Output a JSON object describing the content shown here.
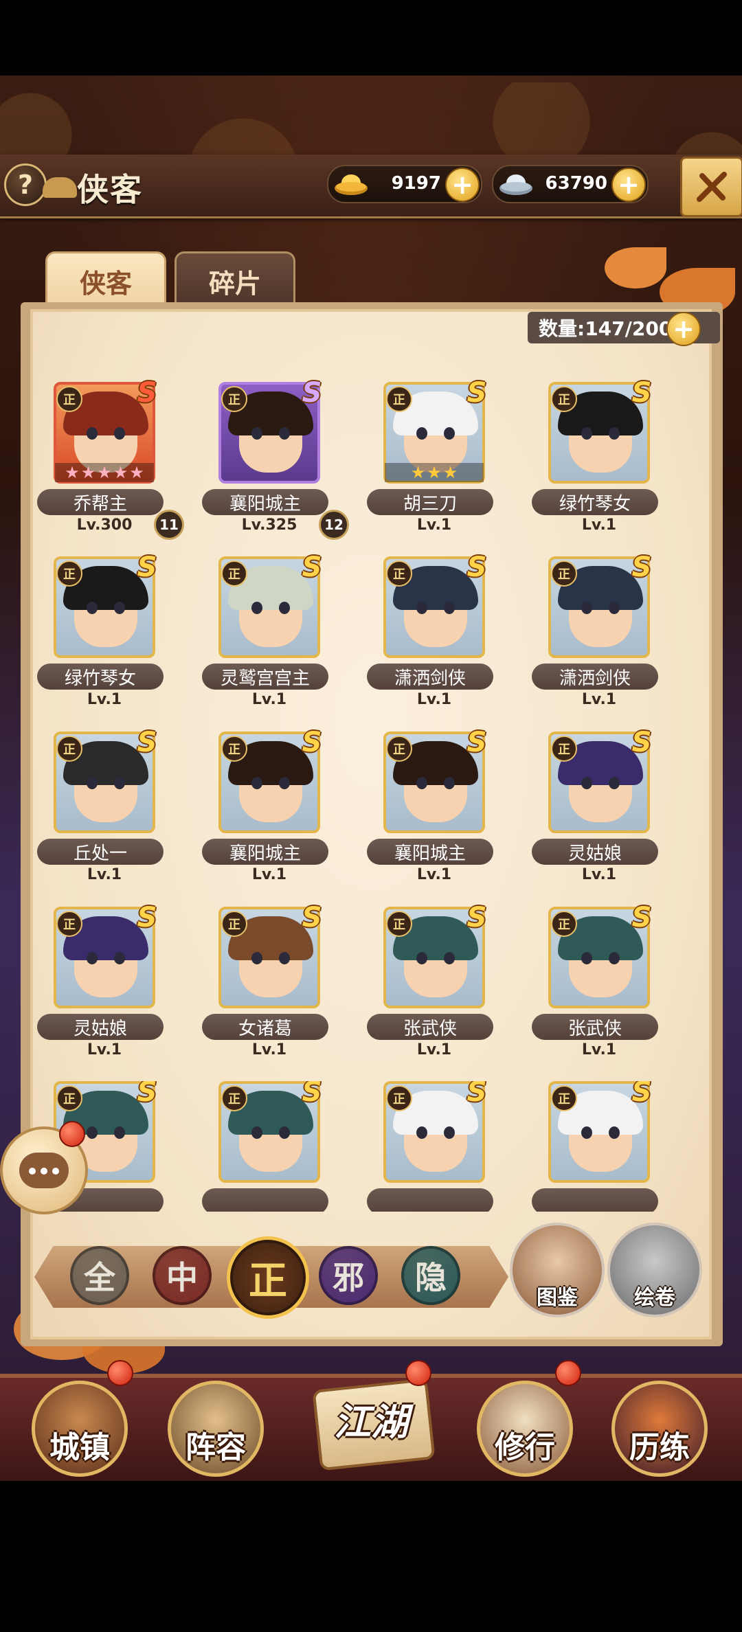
{
  "header": {
    "help_label": "?",
    "title": "侠客",
    "gold": "9197",
    "silver": "63790",
    "plus": "+"
  },
  "tabs": [
    {
      "label": "侠客",
      "active": true
    },
    {
      "label": "碎片",
      "active": false
    }
  ],
  "count_label": "数量:147/200",
  "heroes": [
    {
      "name": "乔帮主",
      "level": "Lv.300",
      "badge": "11",
      "grade": "S",
      "frame": "red",
      "stars": 5,
      "star_color": "pink",
      "hair": "#8a2a1a"
    },
    {
      "name": "襄阳城主",
      "level": "Lv.325",
      "badge": "12",
      "grade": "S",
      "frame": "purple",
      "stars": 0,
      "hair": "#2a1a12"
    },
    {
      "name": "胡三刀",
      "level": "Lv.1",
      "badge": "",
      "grade": "S",
      "frame": "gold",
      "stars": 3,
      "star_color": "gold",
      "hair": "#f2f2f2"
    },
    {
      "name": "绿竹琴女",
      "level": "Lv.1",
      "badge": "",
      "grade": "S",
      "frame": "gold",
      "stars": 0,
      "hair": "#1a1a1a"
    },
    {
      "name": "绿竹琴女",
      "level": "Lv.1",
      "badge": "",
      "grade": "S",
      "frame": "gold",
      "stars": 0,
      "hair": "#1a1a1a"
    },
    {
      "name": "灵鹫宫宫主",
      "level": "Lv.1",
      "badge": "",
      "grade": "S",
      "frame": "gold",
      "stars": 0,
      "hair": "#cfd6c6"
    },
    {
      "name": "潇洒剑侠",
      "level": "Lv.1",
      "badge": "",
      "grade": "S",
      "frame": "gold",
      "stars": 0,
      "hair": "#2a3448"
    },
    {
      "name": "潇洒剑侠",
      "level": "Lv.1",
      "badge": "",
      "grade": "S",
      "frame": "gold",
      "stars": 0,
      "hair": "#2a3448"
    },
    {
      "name": "丘处一",
      "level": "Lv.1",
      "badge": "",
      "grade": "S",
      "frame": "gold",
      "stars": 0,
      "hair": "#2a2a2a"
    },
    {
      "name": "襄阳城主",
      "level": "Lv.1",
      "badge": "",
      "grade": "S",
      "frame": "gold",
      "stars": 0,
      "hair": "#2a1a12"
    },
    {
      "name": "襄阳城主",
      "level": "Lv.1",
      "badge": "",
      "grade": "S",
      "frame": "gold",
      "stars": 0,
      "hair": "#2a1a12"
    },
    {
      "name": "灵姑娘",
      "level": "Lv.1",
      "badge": "",
      "grade": "S",
      "frame": "gold",
      "stars": 0,
      "hair": "#3a2c6a"
    },
    {
      "name": "灵姑娘",
      "level": "Lv.1",
      "badge": "",
      "grade": "S",
      "frame": "gold",
      "stars": 0,
      "hair": "#3a2c6a"
    },
    {
      "name": "女诸葛",
      "level": "Lv.1",
      "badge": "",
      "grade": "S",
      "frame": "gold",
      "stars": 0,
      "hair": "#7a4a2a"
    },
    {
      "name": "张武侠",
      "level": "Lv.1",
      "badge": "",
      "grade": "S",
      "frame": "gold",
      "stars": 0,
      "hair": "#2f5a58"
    },
    {
      "name": "张武侠",
      "level": "Lv.1",
      "badge": "",
      "grade": "S",
      "frame": "gold",
      "stars": 0,
      "hair": "#2f5a58"
    },
    {
      "name": "",
      "level": "",
      "badge": "",
      "grade": "S",
      "frame": "gold",
      "stars": 0,
      "hair": "#2f5a58"
    },
    {
      "name": "",
      "level": "",
      "badge": "",
      "grade": "S",
      "frame": "gold",
      "stars": 0,
      "hair": "#2f5a58"
    },
    {
      "name": "",
      "level": "",
      "badge": "",
      "grade": "S",
      "frame": "gold",
      "stars": 0,
      "hair": "#f2f2f2"
    },
    {
      "name": "",
      "level": "",
      "badge": "",
      "grade": "S",
      "frame": "gold",
      "stars": 0,
      "hair": "#f2f2f2"
    }
  ],
  "faction_tag": "正",
  "filters": [
    {
      "label": "全",
      "color": "#6b6155",
      "active": false
    },
    {
      "label": "中",
      "color": "#7a2a26",
      "active": false
    },
    {
      "label": "正",
      "color": "#4a2a16",
      "active": true
    },
    {
      "label": "邪",
      "color": "#4a2a74",
      "active": false
    },
    {
      "label": "隐",
      "color": "#2a5a5a",
      "active": false
    }
  ],
  "side_buttons": [
    {
      "label": "图鉴"
    },
    {
      "label": "绘卷"
    }
  ],
  "nav": [
    {
      "label": "城镇",
      "dot": true
    },
    {
      "label": "阵容",
      "dot": false
    },
    {
      "label": "江湖",
      "dot": true
    },
    {
      "label": "修行",
      "dot": true
    },
    {
      "label": "历练",
      "dot": false
    }
  ],
  "colors": {
    "accent_gold": "#e2b64a",
    "name_plate": "#6d5a52",
    "panel_bg": "#f4e3c6"
  }
}
